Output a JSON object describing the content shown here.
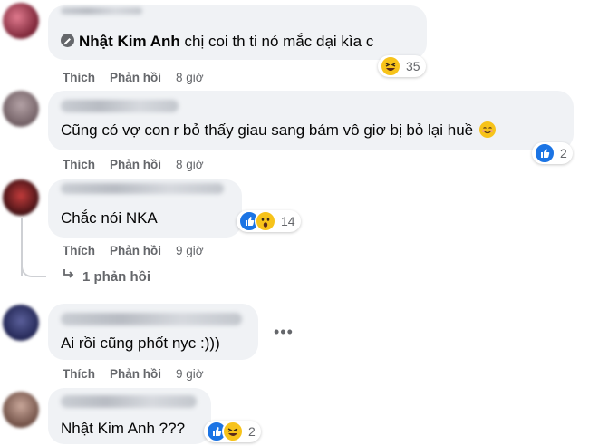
{
  "colors": {
    "like": "#1b74e4",
    "emoji_yellow": "#f7c31a",
    "bubble": "#f0f2f5",
    "meta": "#65676b"
  },
  "comments": [
    {
      "author": "Nhật Kim Anh",
      "text": "chị coi th ti nó mắc dại kìa c",
      "actions": {
        "like": "Thích",
        "reply": "Phản hồi",
        "time": "8 giờ"
      },
      "reactions": {
        "icons": [
          "haha-emoji-icon"
        ],
        "count": "35"
      }
    },
    {
      "text": "Cũng có vợ con r bỏ thấy giau sang bám vô giơ bị bỏ lại huề",
      "actions": {
        "like": "Thích",
        "reply": "Phản hồi",
        "time": "8 giờ"
      },
      "reactions": {
        "icons": [
          "like-icon"
        ],
        "count": "2"
      }
    },
    {
      "text": "Chắc nói NKA",
      "actions": {
        "like": "Thích",
        "reply": "Phản hồi",
        "time": "9 giờ"
      },
      "reactions": {
        "icons": [
          "like-icon",
          "wow-emoji-icon"
        ],
        "count": "14"
      },
      "replies_link": "1 phản hồi"
    },
    {
      "text": "Ai rồi cũng phốt nyc :)))",
      "actions": {
        "like": "Thích",
        "reply": "Phản hồi",
        "time": "9 giờ"
      },
      "more_icon": "more-options-icon"
    },
    {
      "text": "Nhật Kim Anh ???",
      "reactions": {
        "icons": [
          "like-icon",
          "haha-emoji-icon"
        ],
        "count": "2"
      }
    }
  ]
}
